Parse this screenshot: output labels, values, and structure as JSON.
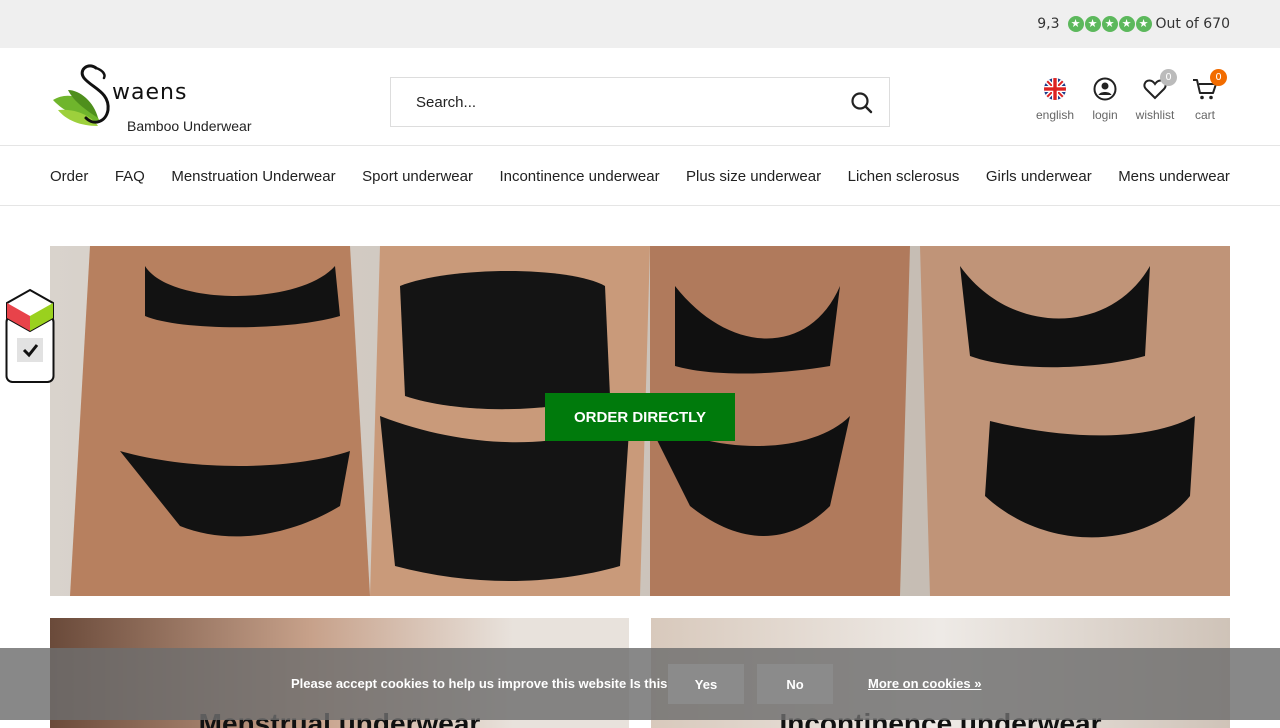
{
  "rating": {
    "score": "9,3",
    "stars": 5,
    "out_of": "Out of 670",
    "color": "#5cb85c"
  },
  "header": {
    "logo_brand": "waens",
    "logo_sub": "Bamboo Underwear",
    "search_placeholder": "Search...",
    "icons": [
      {
        "name": "flag-uk-icon",
        "label": "english"
      },
      {
        "name": "user-icon",
        "label": "login"
      },
      {
        "name": "heart-icon",
        "label": "wishlist",
        "badge": "0"
      },
      {
        "name": "cart-icon",
        "label": "cart",
        "badge": "0"
      }
    ]
  },
  "nav": {
    "items": [
      "Order",
      "FAQ",
      "Menstruation Underwear",
      "Sport underwear",
      "Incontinence underwear",
      "Plus size underwear",
      "Lichen sclerosus",
      "Girls underwear",
      "Mens underwear"
    ]
  },
  "hero": {
    "button_label": "ORDER DIRECTLY",
    "button_color": "#007a0c"
  },
  "tiles": [
    {
      "title": "Menstrual underwear"
    },
    {
      "title": "Incontinence underwear"
    }
  ],
  "cookie": {
    "message": "Please accept cookies to help us improve this website Is this OK?",
    "yes": "Yes",
    "no": "No",
    "more": "More on cookies »"
  }
}
